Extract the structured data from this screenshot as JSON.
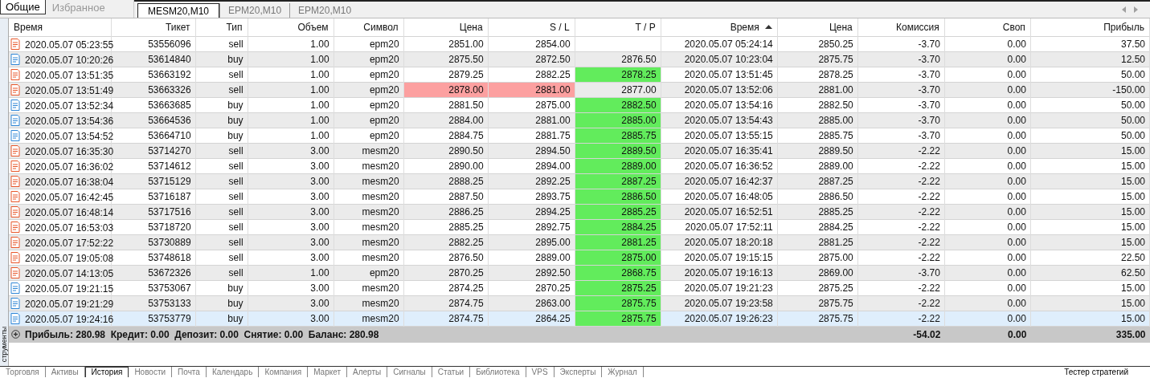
{
  "top_tabs": [
    {
      "label": "Общие",
      "selected": true
    },
    {
      "label": "Избранное",
      "selected": false
    }
  ],
  "chart_tabs": [
    {
      "label": "MESM20,M10",
      "selected": true
    },
    {
      "label": "EPM20,M10",
      "selected": false
    },
    {
      "label": "EPM20,M10",
      "selected": false
    }
  ],
  "side_panel": {
    "title": "струменты"
  },
  "table": {
    "columns": [
      {
        "label": "Время",
        "sorted": false
      },
      {
        "label": "Тикет",
        "sorted": false
      },
      {
        "label": "Тип",
        "sorted": false
      },
      {
        "label": "Объем",
        "sorted": false
      },
      {
        "label": "Символ",
        "sorted": false
      },
      {
        "label": "Цена",
        "sorted": false
      },
      {
        "label": "S / L",
        "sorted": false
      },
      {
        "label": "T / P",
        "sorted": false
      },
      {
        "label": "Время",
        "sorted": true
      },
      {
        "label": "Цена",
        "sorted": false
      },
      {
        "label": "Комиссия",
        "sorted": false
      },
      {
        "label": "Своп",
        "sorted": false
      },
      {
        "label": "Прибыль",
        "sorted": false
      }
    ],
    "rows": [
      {
        "kind": "sell",
        "selected": false,
        "tp_hit": false,
        "sl_hit": false,
        "open_time": "2020.05.07 05:23:55",
        "ticket": "53556096",
        "type": "sell",
        "volume": "1.00",
        "symbol": "epm20",
        "open_price": "2851.00",
        "sl": "2854.00",
        "close_time": "2020.05.07 05:24:14",
        "close_price": "2850.25",
        "commission": "-3.70",
        "swap": "0.00",
        "profit": "37.50"
      },
      {
        "kind": "buy",
        "selected": false,
        "tp_hit": false,
        "sl_hit": false,
        "open_time": "2020.05.07 10:20:26",
        "ticket": "53614840",
        "type": "buy",
        "volume": "1.00",
        "symbol": "epm20",
        "open_price": "2875.50",
        "sl": "2872.50",
        "tp": "2876.50",
        "close_time": "2020.05.07 10:23:04",
        "close_price": "2875.75",
        "commission": "-3.70",
        "swap": "0.00",
        "profit": "12.50"
      },
      {
        "kind": "sell",
        "selected": false,
        "tp_hit": true,
        "sl_hit": false,
        "open_time": "2020.05.07 13:51:35",
        "ticket": "53663192",
        "type": "sell",
        "volume": "1.00",
        "symbol": "epm20",
        "open_price": "2879.25",
        "sl": "2882.25",
        "tp": "2878.25",
        "close_time": "2020.05.07 13:51:45",
        "close_price": "2878.25",
        "commission": "-3.70",
        "swap": "0.00",
        "profit": "50.00"
      },
      {
        "kind": "sell",
        "selected": false,
        "tp_hit": false,
        "sl_hit": true,
        "open_time": "2020.05.07 13:51:49",
        "ticket": "53663326",
        "type": "sell",
        "volume": "1.00",
        "symbol": "epm20",
        "open_price": "2878.00",
        "sl": "2881.00",
        "tp": "2877.00",
        "close_time": "2020.05.07 13:52:06",
        "close_price": "2881.00",
        "commission": "-3.70",
        "swap": "0.00",
        "profit": "-150.00"
      },
      {
        "kind": "buy",
        "selected": false,
        "tp_hit": true,
        "sl_hit": false,
        "open_time": "2020.05.07 13:52:34",
        "ticket": "53663685",
        "type": "buy",
        "volume": "1.00",
        "symbol": "epm20",
        "open_price": "2881.50",
        "sl": "2875.00",
        "tp": "2882.50",
        "close_time": "2020.05.07 13:54:16",
        "close_price": "2882.50",
        "commission": "-3.70",
        "swap": "0.00",
        "profit": "50.00"
      },
      {
        "kind": "buy",
        "selected": false,
        "tp_hit": true,
        "sl_hit": false,
        "open_time": "2020.05.07 13:54:36",
        "ticket": "53664536",
        "type": "buy",
        "volume": "1.00",
        "symbol": "epm20",
        "open_price": "2884.00",
        "sl": "2881.00",
        "tp": "2885.00",
        "close_time": "2020.05.07 13:54:43",
        "close_price": "2885.00",
        "commission": "-3.70",
        "swap": "0.00",
        "profit": "50.00"
      },
      {
        "kind": "buy",
        "selected": false,
        "tp_hit": true,
        "sl_hit": false,
        "open_time": "2020.05.07 13:54:52",
        "ticket": "53664710",
        "type": "buy",
        "volume": "1.00",
        "symbol": "epm20",
        "open_price": "2884.75",
        "sl": "2881.75",
        "tp": "2885.75",
        "close_time": "2020.05.07 13:55:15",
        "close_price": "2885.75",
        "commission": "-3.70",
        "swap": "0.00",
        "profit": "50.00"
      },
      {
        "kind": "sell",
        "selected": false,
        "tp_hit": true,
        "sl_hit": false,
        "open_time": "2020.05.07 16:35:30",
        "ticket": "53714270",
        "type": "sell",
        "volume": "3.00",
        "symbol": "mesm20",
        "open_price": "2890.50",
        "sl": "2894.50",
        "tp": "2889.50",
        "close_time": "2020.05.07 16:35:41",
        "close_price": "2889.50",
        "commission": "-2.22",
        "swap": "0.00",
        "profit": "15.00"
      },
      {
        "kind": "sell",
        "selected": false,
        "tp_hit": true,
        "sl_hit": false,
        "open_time": "2020.05.07 16:36:02",
        "ticket": "53714612",
        "type": "sell",
        "volume": "3.00",
        "symbol": "mesm20",
        "open_price": "2890.00",
        "sl": "2894.00",
        "tp": "2889.00",
        "close_time": "2020.05.07 16:36:52",
        "close_price": "2889.00",
        "commission": "-2.22",
        "swap": "0.00",
        "profit": "15.00"
      },
      {
        "kind": "sell",
        "selected": false,
        "tp_hit": true,
        "sl_hit": false,
        "open_time": "2020.05.07 16:38:04",
        "ticket": "53715129",
        "type": "sell",
        "volume": "3.00",
        "symbol": "mesm20",
        "open_price": "2888.25",
        "sl": "2892.25",
        "tp": "2887.25",
        "close_time": "2020.05.07 16:42:37",
        "close_price": "2887.25",
        "commission": "-2.22",
        "swap": "0.00",
        "profit": "15.00"
      },
      {
        "kind": "sell",
        "selected": false,
        "tp_hit": true,
        "sl_hit": false,
        "open_time": "2020.05.07 16:42:45",
        "ticket": "53716187",
        "type": "sell",
        "volume": "3.00",
        "symbol": "mesm20",
        "open_price": "2887.50",
        "sl": "2893.75",
        "tp": "2886.50",
        "close_time": "2020.05.07 16:48:05",
        "close_price": "2886.50",
        "commission": "-2.22",
        "swap": "0.00",
        "profit": "15.00"
      },
      {
        "kind": "sell",
        "selected": false,
        "tp_hit": true,
        "sl_hit": false,
        "open_time": "2020.05.07 16:48:14",
        "ticket": "53717516",
        "type": "sell",
        "volume": "3.00",
        "symbol": "mesm20",
        "open_price": "2886.25",
        "sl": "2894.25",
        "tp": "2885.25",
        "close_time": "2020.05.07 16:52:51",
        "close_price": "2885.25",
        "commission": "-2.22",
        "swap": "0.00",
        "profit": "15.00"
      },
      {
        "kind": "sell",
        "selected": false,
        "tp_hit": true,
        "sl_hit": false,
        "open_time": "2020.05.07 16:53:03",
        "ticket": "53718720",
        "type": "sell",
        "volume": "3.00",
        "symbol": "mesm20",
        "open_price": "2885.25",
        "sl": "2892.75",
        "tp": "2884.25",
        "close_time": "2020.05.07 17:52:11",
        "close_price": "2884.25",
        "commission": "-2.22",
        "swap": "0.00",
        "profit": "15.00"
      },
      {
        "kind": "sell",
        "selected": false,
        "tp_hit": true,
        "sl_hit": false,
        "open_time": "2020.05.07 17:52:22",
        "ticket": "53730889",
        "type": "sell",
        "volume": "3.00",
        "symbol": "mesm20",
        "open_price": "2882.25",
        "sl": "2895.00",
        "tp": "2881.25",
        "close_time": "2020.05.07 18:20:18",
        "close_price": "2881.25",
        "commission": "-2.22",
        "swap": "0.00",
        "profit": "15.00"
      },
      {
        "kind": "sell",
        "selected": false,
        "tp_hit": true,
        "sl_hit": false,
        "open_time": "2020.05.07 19:05:08",
        "ticket": "53748618",
        "type": "sell",
        "volume": "3.00",
        "symbol": "mesm20",
        "open_price": "2876.50",
        "sl": "2889.00",
        "tp": "2875.00",
        "close_time": "2020.05.07 19:15:15",
        "close_price": "2875.00",
        "commission": "-2.22",
        "swap": "0.00",
        "profit": "22.50"
      },
      {
        "kind": "sell",
        "selected": false,
        "tp_hit": true,
        "sl_hit": false,
        "open_time": "2020.05.07 14:13:05",
        "ticket": "53672326",
        "type": "sell",
        "volume": "1.00",
        "symbol": "epm20",
        "open_price": "2870.25",
        "sl": "2892.50",
        "tp": "2868.75",
        "close_time": "2020.05.07 19:16:13",
        "close_price": "2869.00",
        "commission": "-3.70",
        "swap": "0.00",
        "profit": "62.50"
      },
      {
        "kind": "buy",
        "selected": false,
        "tp_hit": true,
        "sl_hit": false,
        "open_time": "2020.05.07 19:21:15",
        "ticket": "53753067",
        "type": "buy",
        "volume": "3.00",
        "symbol": "mesm20",
        "open_price": "2874.25",
        "sl": "2870.25",
        "tp": "2875.25",
        "close_time": "2020.05.07 19:21:23",
        "close_price": "2875.25",
        "commission": "-2.22",
        "swap": "0.00",
        "profit": "15.00"
      },
      {
        "kind": "buy",
        "selected": false,
        "tp_hit": true,
        "sl_hit": false,
        "open_time": "2020.05.07 19:21:29",
        "ticket": "53753133",
        "type": "buy",
        "volume": "3.00",
        "symbol": "mesm20",
        "open_price": "2874.75",
        "sl": "2863.00",
        "tp": "2875.75",
        "close_time": "2020.05.07 19:23:58",
        "close_price": "2875.75",
        "commission": "-2.22",
        "swap": "0.00",
        "profit": "15.00"
      },
      {
        "kind": "buy",
        "selected": true,
        "tp_hit": true,
        "sl_hit": false,
        "open_time": "2020.05.07 19:24:16",
        "ticket": "53753779",
        "type": "buy",
        "volume": "3.00",
        "symbol": "mesm20",
        "open_price": "2874.75",
        "sl": "2864.25",
        "tp": "2875.75",
        "close_time": "2020.05.07 19:26:23",
        "close_price": "2875.75",
        "commission": "-2.22",
        "swap": "0.00",
        "profit": "15.00"
      }
    ],
    "summary": {
      "text": "Прибыль: 280.98  Кредит: 0.00  Депозит: 0.00  Снятие: 0.00  Баланс: 280.98",
      "commission": "-54.02",
      "swap": "0.00",
      "profit": "335.00"
    }
  },
  "bottom_tabs": [
    {
      "label": "Торговля",
      "selected": false
    },
    {
      "label": "Активы",
      "selected": false
    },
    {
      "label": "История",
      "selected": true
    },
    {
      "label": "Новости",
      "selected": false
    },
    {
      "label": "Почта",
      "selected": false
    },
    {
      "label": "Календарь",
      "selected": false
    },
    {
      "label": "Компания",
      "selected": false
    },
    {
      "label": "Маркет",
      "selected": false
    },
    {
      "label": "Алерты",
      "selected": false
    },
    {
      "label": "Сигналы",
      "selected": false
    },
    {
      "label": "Статьи",
      "selected": false
    },
    {
      "label": "Библиотека",
      "selected": false
    },
    {
      "label": "VPS",
      "selected": false
    },
    {
      "label": "Эксперты",
      "selected": false
    },
    {
      "label": "Журнал",
      "selected": false
    }
  ],
  "right_tab": {
    "label": "Тестер стратегий"
  }
}
